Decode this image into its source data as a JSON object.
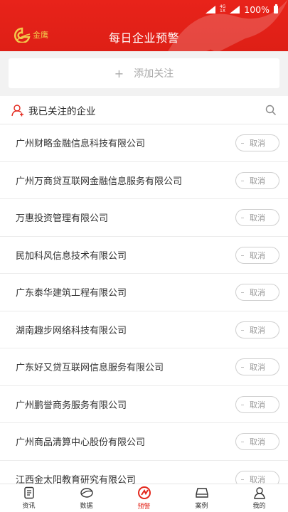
{
  "status_bar": {
    "network": "4G",
    "network2": "1X",
    "battery": "100%"
  },
  "header": {
    "title": "每日企业预警",
    "logo_text": "金鹰"
  },
  "add_bar": {
    "plus": "+",
    "label": "添加关注"
  },
  "section": {
    "title": "我已关注的企业"
  },
  "cancel_label": "取消",
  "companies": [
    "广州财略金融信息科技有限公司",
    "广州万商贷互联网金融信息服务有限公司",
    "万惠投资管理有限公司",
    "民加科风信息技术有限公司",
    "广东泰华建筑工程有限公司",
    "湖南趣步网络科技有限公司",
    "广东好又贷互联网信息服务有限公司",
    "广州鹏誉商务服务有限公司",
    "广州商品清算中心股份有限公司",
    "江西金太阳教育研究有限公司"
  ],
  "nav": [
    {
      "label": "资讯",
      "icon": "news-icon"
    },
    {
      "label": "数据",
      "icon": "data-icon"
    },
    {
      "label": "预警",
      "icon": "alert-icon"
    },
    {
      "label": "案例",
      "icon": "case-icon"
    },
    {
      "label": "我的",
      "icon": "profile-icon"
    }
  ],
  "colors": {
    "accent": "#e3271c",
    "header": "#e8231a",
    "logo": "#f3c84b"
  }
}
